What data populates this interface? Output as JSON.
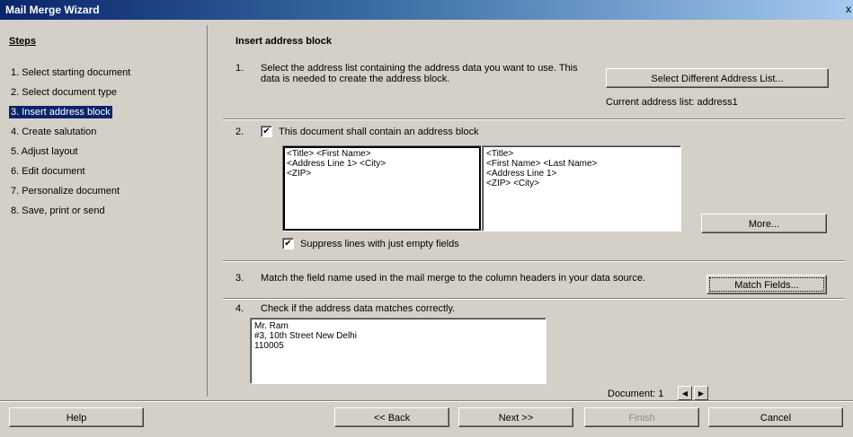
{
  "window": {
    "title": "Mail Merge Wizard",
    "close_glyph": "x"
  },
  "steps": {
    "title": "Steps",
    "items": [
      {
        "label": "1. Select starting document",
        "active": false
      },
      {
        "label": "2. Select document type",
        "active": false
      },
      {
        "label": "3. Insert address block",
        "active": true
      },
      {
        "label": "4. Create salutation",
        "active": false
      },
      {
        "label": "5. Adjust layout",
        "active": false
      },
      {
        "label": "6. Edit document",
        "active": false
      },
      {
        "label": "7. Personalize document",
        "active": false
      },
      {
        "label": "8. Save, print or send",
        "active": false
      }
    ]
  },
  "main": {
    "title": "Insert address block",
    "section1": {
      "num": "1.",
      "text": "Select the address list containing the address data you want to use. This data is needed to create the address block.",
      "button_label": "Select Different Address List...",
      "current_list": "Current address list: address1"
    },
    "section2": {
      "num": "2.",
      "checkbox_label": "This document shall contain an address block",
      "checked": true,
      "block_option_1": [
        "<Title> <First Name>",
        "<Address Line 1> <City>",
        "<ZIP>"
      ],
      "block_option_2": [
        "<Title>",
        "<First Name> <Last Name>",
        "<Address Line 1>",
        "<ZIP> <City>"
      ],
      "more_button": "More...",
      "suppress_label": "Suppress lines with just empty fields",
      "suppress_checked": true
    },
    "section3": {
      "num": "3.",
      "text": "Match the field name used in the mail merge to the column headers in your data source.",
      "button_label": "Match Fields..."
    },
    "section4": {
      "num": "4.",
      "text": "Check if the address data matches correctly.",
      "preview_lines": [
        "Mr. Ram",
        "#3, 10th Street New Delhi",
        "110005"
      ],
      "document_label": "Document: 1",
      "prev_glyph": "◀",
      "next_glyph": "▶"
    }
  },
  "footer": {
    "help": "Help",
    "back": "<< Back",
    "next": "Next >>",
    "finish": "Finish",
    "cancel": "Cancel"
  }
}
